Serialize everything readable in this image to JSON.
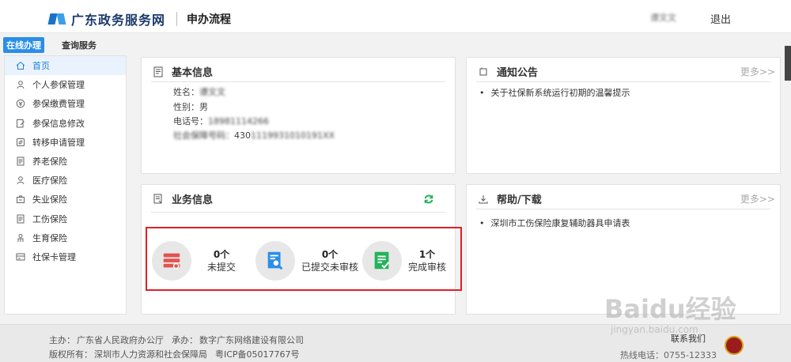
{
  "header": {
    "site_name": "广东政务服务网",
    "page_title": "申办流程",
    "user_name": "谭文文",
    "logout": "退出"
  },
  "subtabs": [
    "在线办理",
    "查询服务"
  ],
  "sidebar": {
    "items": [
      {
        "label": "首页",
        "icon": "home-icon"
      },
      {
        "label": "个人参保管理",
        "icon": "person-icon"
      },
      {
        "label": "参保缴费管理",
        "icon": "payment-icon"
      },
      {
        "label": "参保信息修改",
        "icon": "edit-icon"
      },
      {
        "label": "转移申请管理",
        "icon": "transfer-icon"
      },
      {
        "label": "养老保险",
        "icon": "doc-icon"
      },
      {
        "label": "医疗保险",
        "icon": "person-icon"
      },
      {
        "label": "失业保险",
        "icon": "briefcase-icon"
      },
      {
        "label": "工伤保险",
        "icon": "doc-icon"
      },
      {
        "label": "生育保险",
        "icon": "baby-icon"
      },
      {
        "label": "社保卡管理",
        "icon": "card-icon"
      }
    ]
  },
  "basic_info": {
    "title": "基本信息",
    "name_label": "姓名：",
    "name_value": "谭文文",
    "gender_label": "性别：",
    "gender_value": "男",
    "phone_label": "电话号：",
    "phone_value": "18981114266",
    "ssn_label": "社会保障号码：",
    "ssn_value": "430",
    "ssn_masked": "1119931010191XX"
  },
  "notice": {
    "title": "通知公告",
    "more": "更多>>",
    "items": [
      "关于社保新系统运行初期的温馨提示"
    ]
  },
  "business": {
    "title": "业务信息",
    "stats": [
      {
        "count": "0个",
        "label": "未提交",
        "icon": "stack-icon"
      },
      {
        "count": "0个",
        "label": "已提交未审核",
        "icon": "search-doc-icon"
      },
      {
        "count": "1个",
        "label": "完成审核",
        "icon": "checklist-icon"
      }
    ]
  },
  "help": {
    "title": "帮助/下载",
    "more": "更多>>",
    "items": [
      "深圳市工伤保险康复辅助器具申请表"
    ]
  },
  "footer": {
    "host_label": "主办：",
    "host": "广东省人民政府办公厅",
    "organizer_label": "承办：",
    "organizer": "数字广东网络建设有限公司",
    "copyright_label": "版权所有：",
    "copyright": "深圳市人力资源和社会保障局",
    "icp": "粤ICP备05017767号",
    "contact": "联系我们",
    "hotline": "热线电话：0755-12333"
  },
  "watermark": {
    "text": "Baidu经验",
    "sub": "jingyan.baidu.com"
  },
  "colors": {
    "accent": "#2a8ee8",
    "highlight_box": "#e21e26",
    "stat_red": "#e2534f",
    "stat_blue": "#2a8ee8",
    "stat_green": "#23b35a"
  }
}
